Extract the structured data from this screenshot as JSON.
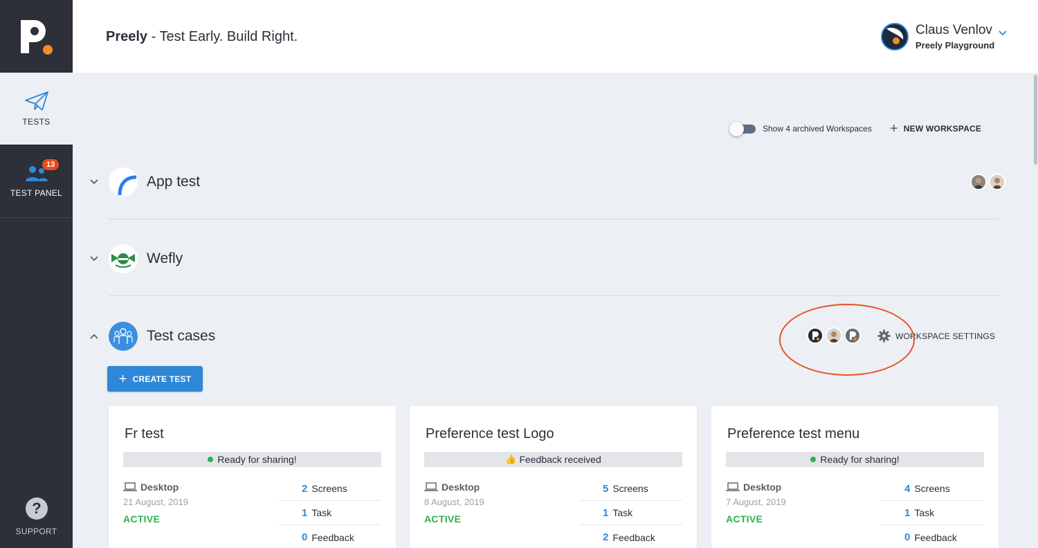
{
  "app": {
    "brand": "Preely",
    "tagline": " - Test Early. Build Right."
  },
  "user": {
    "name": "Claus Venlov",
    "org": "Preely Playground"
  },
  "sidebar": {
    "tests_label": "TESTS",
    "panel_label": "TEST PANEL",
    "panel_badge": "13",
    "support_label": "SUPPORT"
  },
  "toolbar": {
    "archived_label": "Show 4 archived Workspaces",
    "archived_toggle": false,
    "new_workspace_label": "NEW WORKSPACE"
  },
  "workspaces": [
    {
      "name": "App test",
      "expanded": false
    },
    {
      "name": "Wefly",
      "expanded": false
    },
    {
      "name": "Test cases",
      "expanded": true
    }
  ],
  "workspace_settings_label": "WORKSPACE SETTINGS",
  "create_test_label": "CREATE TEST",
  "cards": [
    {
      "title": "Fr test",
      "status": "Ready for sharing!",
      "device": "Desktop",
      "date": "21 August, 2019",
      "state": "ACTIVE",
      "screens_num": "2",
      "screens_label": "Screens",
      "task_num": "1",
      "task_label": "Task",
      "feedback_num": "0",
      "feedback_label": "Feedback"
    },
    {
      "title": "Preference test Logo",
      "status": "Feedback received",
      "device": "Desktop",
      "date": "8 August, 2019",
      "state": "ACTIVE",
      "screens_num": "5",
      "screens_label": "Screens",
      "task_num": "1",
      "task_label": "Task",
      "feedback_num": "2",
      "feedback_label": "Feedback"
    },
    {
      "title": "Preference test menu",
      "status": "Ready for sharing!",
      "device": "Desktop",
      "date": "7 August, 2019",
      "state": "ACTIVE",
      "screens_num": "4",
      "screens_label": "Screens",
      "task_num": "1",
      "task_label": "Task",
      "feedback_num": "0",
      "feedback_label": "Feedback"
    }
  ],
  "colors": {
    "sidebar": "#2d2f39",
    "accent_blue": "#2f87d8",
    "badge": "#e94b1f",
    "active_green": "#2bb24c",
    "highlight_orange": "#e8502a"
  }
}
